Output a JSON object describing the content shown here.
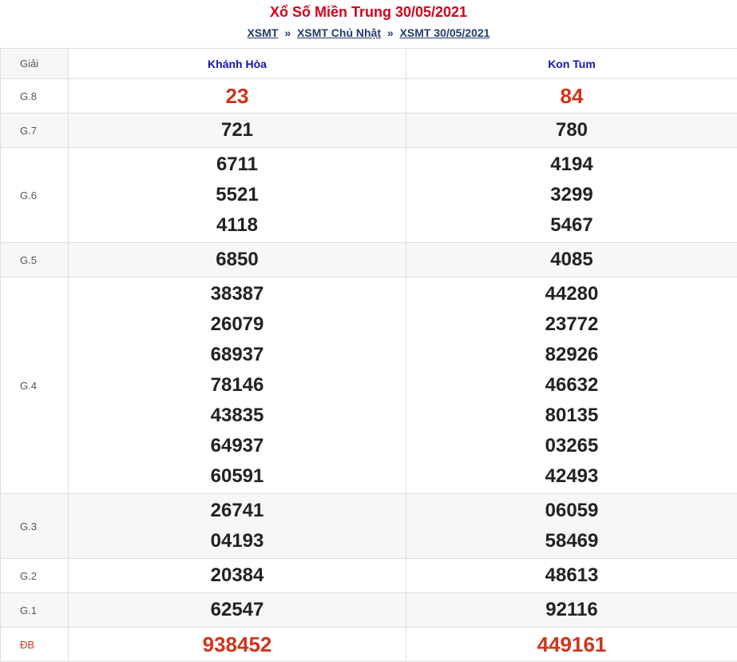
{
  "title": "Xổ Số Miền Trung 30/05/2021",
  "breadcrumb": {
    "items": [
      "XSMT",
      "XSMT Chủ Nhật",
      "XSMT 30/05/2021"
    ],
    "separator": "»"
  },
  "header": {
    "prize_col": "Giải",
    "provinces": [
      "Khánh Hòa",
      "Kon Tum"
    ]
  },
  "rows": [
    {
      "label": "G.8",
      "shaded": false,
      "red": true,
      "cols": [
        [
          "23"
        ],
        [
          "84"
        ]
      ]
    },
    {
      "label": "G.7",
      "shaded": true,
      "red": false,
      "cols": [
        [
          "721"
        ],
        [
          "780"
        ]
      ]
    },
    {
      "label": "G.6",
      "shaded": false,
      "red": false,
      "cols": [
        [
          "6711",
          "5521",
          "4118"
        ],
        [
          "4194",
          "3299",
          "5467"
        ]
      ]
    },
    {
      "label": "G.5",
      "shaded": true,
      "red": false,
      "cols": [
        [
          "6850"
        ],
        [
          "4085"
        ]
      ]
    },
    {
      "label": "G.4",
      "shaded": false,
      "red": false,
      "cols": [
        [
          "38387",
          "26079",
          "68937",
          "78146",
          "43835",
          "64937",
          "60591"
        ],
        [
          "44280",
          "23772",
          "82926",
          "46632",
          "80135",
          "03265",
          "42493"
        ]
      ]
    },
    {
      "label": "G.3",
      "shaded": true,
      "red": false,
      "cols": [
        [
          "26741",
          "04193"
        ],
        [
          "06059",
          "58469"
        ]
      ]
    },
    {
      "label": "G.2",
      "shaded": false,
      "red": false,
      "cols": [
        [
          "20384"
        ],
        [
          "48613"
        ]
      ]
    },
    {
      "label": "G.1",
      "shaded": true,
      "red": false,
      "cols": [
        [
          "62547"
        ],
        [
          "92116"
        ]
      ]
    },
    {
      "label": "ĐB",
      "shaded": false,
      "red": true,
      "cols": [
        [
          "938452"
        ],
        [
          "449161"
        ]
      ]
    }
  ],
  "colors": {
    "title": "#d0021b",
    "special": "#d0341b",
    "province": "#1a12b5",
    "link": "#223b6e"
  }
}
